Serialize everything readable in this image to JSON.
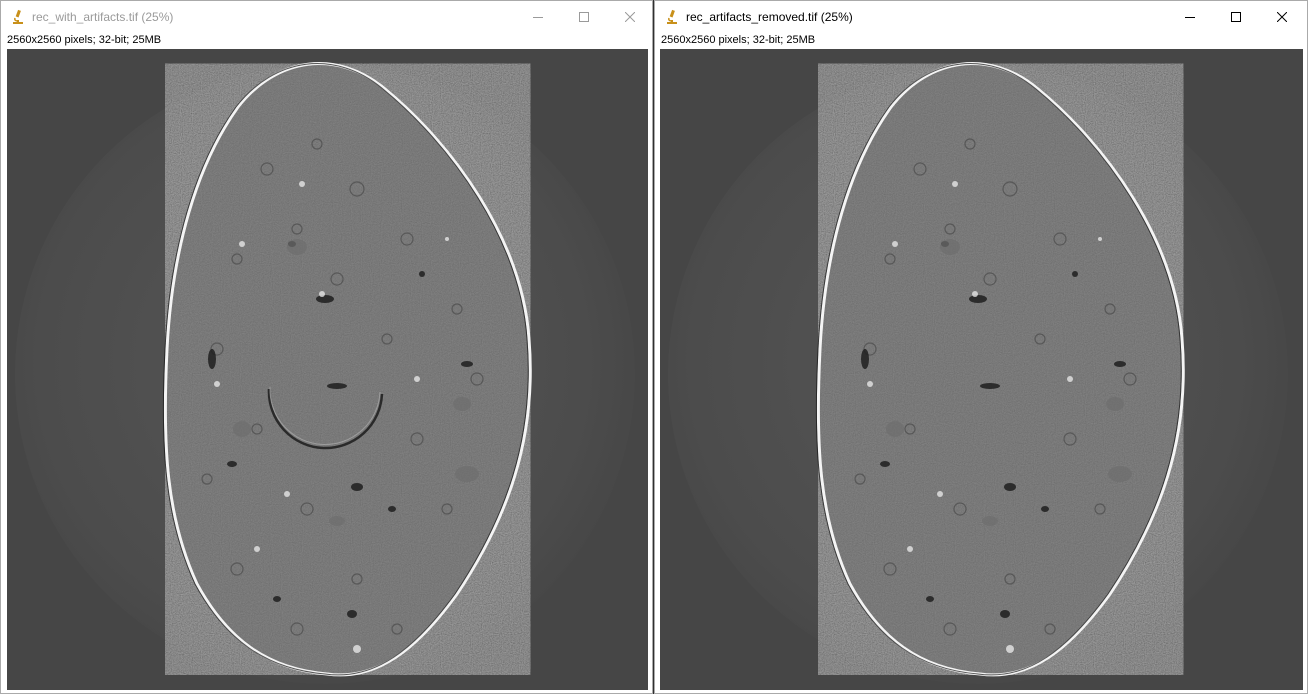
{
  "windows": [
    {
      "id": "left",
      "title": "rec_with_artifacts.tif (25%)",
      "info": "2560x2560 pixels; 32-bit; 25MB",
      "active": false,
      "has_ring_artifact": true
    },
    {
      "id": "right",
      "title": "rec_artifacts_removed.tif (25%)",
      "info": "2560x2560 pixels; 32-bit; 25MB",
      "active": true,
      "has_ring_artifact": false
    }
  ],
  "controls": {
    "minimize_icon": "minimize-icon",
    "maximize_icon": "maximize-icon",
    "close_icon": "close-icon"
  },
  "icons": {
    "app": "microscope-icon"
  },
  "colors": {
    "canvas_background": "#464646",
    "sample_gray": "#8c8c8c",
    "edge_highlight": "#f4f4f4",
    "inactive_title": "#9a9a9a",
    "active_title": "#000000",
    "icon_gold": "#c8901a"
  }
}
